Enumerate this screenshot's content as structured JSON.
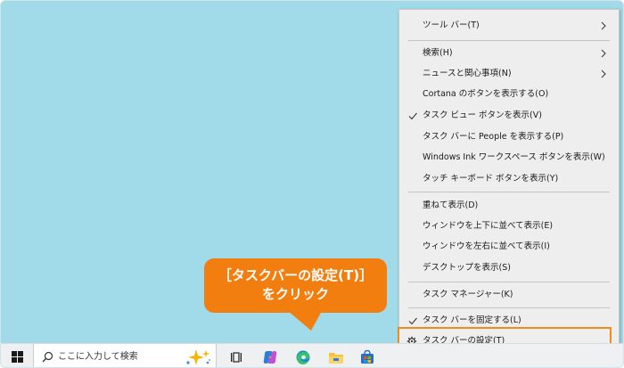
{
  "context_menu": {
    "items": [
      {
        "label": "ツール バー(T)",
        "submenu": true
      },
      {
        "label": "検索(H)",
        "submenu": true
      },
      {
        "label": "ニュースと関心事項(N)",
        "submenu": true
      },
      {
        "label": "Cortana のボタンを表示する(O)"
      },
      {
        "label": "タスク ビュー ボタンを表示(V)",
        "checked": true
      },
      {
        "label": "タスク バーに People を表示する(P)"
      },
      {
        "label": "Windows Ink ワークスペース ボタンを表示(W)"
      },
      {
        "label": "タッチ キーボード ボタンを表示(Y)"
      },
      {
        "label": "重ねて表示(D)"
      },
      {
        "label": "ウィンドウを上下に並べて表示(E)"
      },
      {
        "label": "ウィンドウを左右に並べて表示(I)"
      },
      {
        "label": "デスクトップを表示(S)"
      },
      {
        "label": "タスク マネージャー(K)"
      },
      {
        "label": "タスク バーを固定する(L)",
        "checked": true
      },
      {
        "label": "タスク バーの設定(T)",
        "icon": "gear-icon",
        "highlighted": true
      }
    ]
  },
  "callout": {
    "line1": "［タスクバーの設定(T)］",
    "line2": "をクリック"
  },
  "taskbar": {
    "search_placeholder": "ここに入力して検索",
    "icons": [
      "windows-start-icon",
      "search-icon",
      "copilot-sparkle-icon",
      "task-view-icon",
      "copilot-icon",
      "edge-icon",
      "file-explorer-icon",
      "store-icon"
    ]
  },
  "colors": {
    "desktop": "#a1dae8",
    "accent": "#f37e10",
    "menu_bg": "#eeeeee",
    "taskbar_bg": "#eef0f1"
  }
}
